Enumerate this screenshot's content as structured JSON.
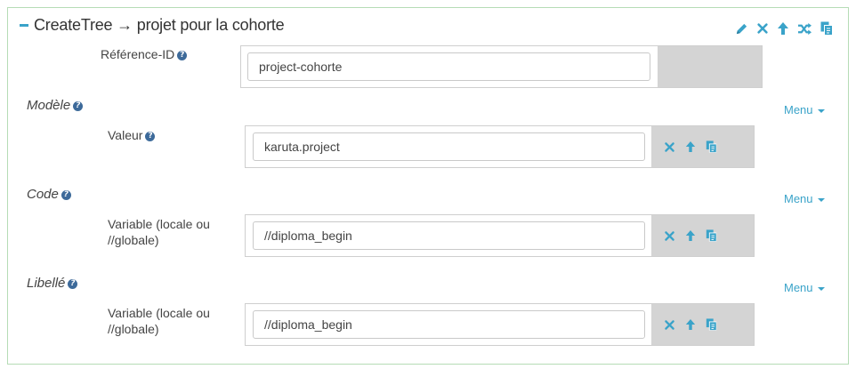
{
  "header": {
    "title": "CreateTree → projet pour la cohorte",
    "icons": [
      "pencil-icon",
      "close-icon",
      "arrow-up-icon",
      "shuffle-icon",
      "copy-icon"
    ]
  },
  "accent_color": "#3aa3c9",
  "reference": {
    "label": "Référence-ID",
    "value": "project-cohorte"
  },
  "sections": [
    {
      "title": "Modèle",
      "menu_label": "Menu",
      "field_label": "Valeur",
      "value": "karuta.project"
    },
    {
      "title": "Code",
      "menu_label": "Menu",
      "field_label_line1": "Variable (locale ou",
      "field_label_line2": "//globale)",
      "value": "//diploma_begin"
    },
    {
      "title": "Libellé",
      "menu_label": "Menu",
      "field_label_line1": "Variable (locale ou",
      "field_label_line2": "//globale)",
      "value": "//diploma_begin"
    }
  ],
  "help_glyph": "?"
}
